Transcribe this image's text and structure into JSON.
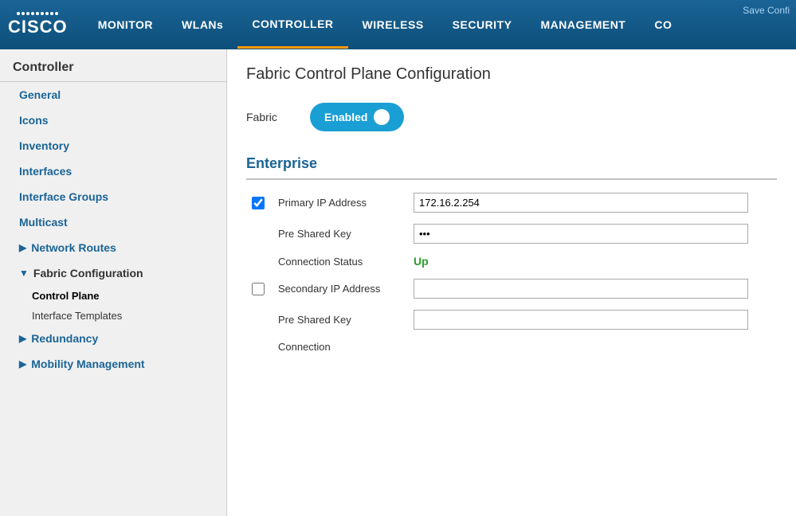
{
  "topbar": {
    "save_config_label": "Save Confi",
    "nav_items": [
      {
        "id": "monitor",
        "label": "MONITOR",
        "active": false
      },
      {
        "id": "wlans",
        "label": "WLANs",
        "active": false
      },
      {
        "id": "controller",
        "label": "CONTROLLER",
        "active": true
      },
      {
        "id": "wireless",
        "label": "WIRELESS",
        "active": false
      },
      {
        "id": "security",
        "label": "SECURITY",
        "active": false
      },
      {
        "id": "management",
        "label": "MANAGEMENT",
        "active": false
      },
      {
        "id": "co",
        "label": "CO",
        "active": false
      }
    ]
  },
  "sidebar": {
    "title": "Controller",
    "items": [
      {
        "id": "general",
        "label": "General",
        "type": "link"
      },
      {
        "id": "icons",
        "label": "Icons",
        "type": "link"
      },
      {
        "id": "inventory",
        "label": "Inventory",
        "type": "link"
      },
      {
        "id": "interfaces",
        "label": "Interfaces",
        "type": "link"
      },
      {
        "id": "interface-groups",
        "label": "Interface Groups",
        "type": "link"
      },
      {
        "id": "multicast",
        "label": "Multicast",
        "type": "link"
      },
      {
        "id": "network-routes",
        "label": "Network Routes",
        "type": "expandable",
        "expanded": false
      },
      {
        "id": "fabric-configuration",
        "label": "Fabric Configuration",
        "type": "expandable",
        "expanded": true
      },
      {
        "id": "redundancy",
        "label": "Redundancy",
        "type": "expandable",
        "expanded": false
      },
      {
        "id": "mobility-management",
        "label": "Mobility Management",
        "type": "expandable",
        "expanded": false
      }
    ],
    "sub_items": [
      {
        "id": "control-plane",
        "label": "Control Plane",
        "active": true
      },
      {
        "id": "interface-templates",
        "label": "Interface Templates",
        "active": false
      }
    ]
  },
  "content": {
    "page_title": "Fabric Control Plane Configuration",
    "fabric_label": "Fabric",
    "fabric_toggle_label": "Enabled",
    "enterprise_section_title": "Enterprise",
    "primary_ip": {
      "label": "Primary IP Address",
      "value": "172.16.2.254",
      "checkbox_checked": true
    },
    "primary_psk": {
      "label": "Pre Shared Key",
      "value": "•••"
    },
    "primary_connection": {
      "label": "Connection Status",
      "value": "Up",
      "status": "up"
    },
    "secondary_ip": {
      "label": "Secondary IP Address",
      "value": "",
      "checkbox_checked": false
    },
    "secondary_psk": {
      "label": "Pre Shared Key",
      "value": ""
    },
    "secondary_connection": {
      "label": "Connection",
      "value": ""
    }
  }
}
